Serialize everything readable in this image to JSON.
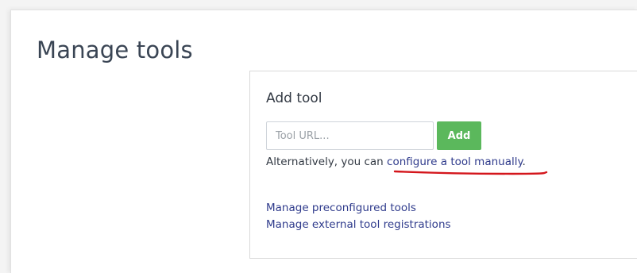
{
  "header": {
    "title": "Manage tools"
  },
  "add_tool": {
    "title": "Add tool",
    "url_placeholder": "Tool URL...",
    "url_value": "",
    "add_label": "Add",
    "alt_prefix": "Alternatively, you can ",
    "alt_link": "configure a tool manually",
    "alt_suffix": ".",
    "annotation_color": "#d4161c"
  },
  "links": {
    "preconfigured": "Manage preconfigured tools",
    "registrations": "Manage external tool registrations"
  },
  "colors": {
    "accent_green": "#5bb85c",
    "link": "#2f3b8c",
    "title_text": "#3a4554"
  }
}
